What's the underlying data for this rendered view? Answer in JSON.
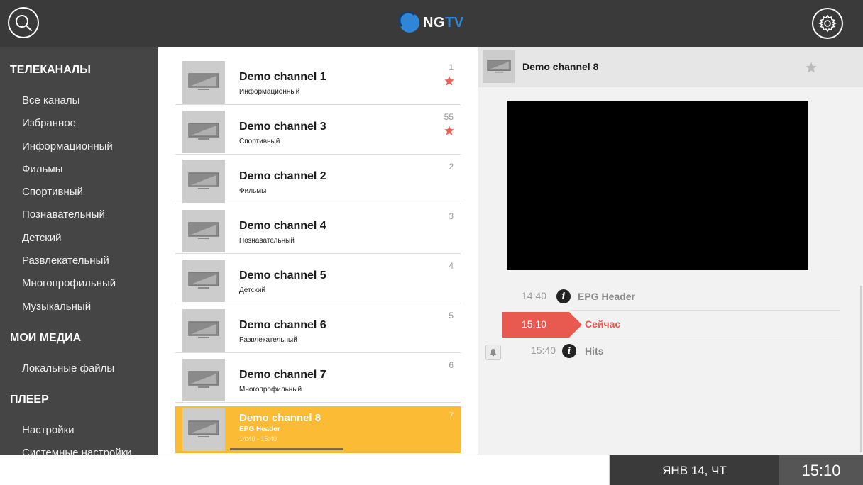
{
  "header": {
    "logo_text": "NG",
    "logo_text_accent": "TV",
    "colors": {
      "bar": "#3a3a3a",
      "accent": "#2f86d6"
    }
  },
  "sidebar": {
    "sections": [
      {
        "title": "ТЕЛЕКАНАЛЫ",
        "items": [
          "Все каналы",
          "Избранное",
          "Информационный",
          "Фильмы",
          "Спортивный",
          "Познавательный",
          "Детский",
          "Развлекательный",
          "Многопрофильный",
          "Музыкальный"
        ]
      },
      {
        "title": "МОИ МЕДИА",
        "items": [
          "Локальные файлы"
        ]
      },
      {
        "title": "ПЛЕЕР",
        "items": [
          "Настройки",
          "Системные настройки"
        ]
      }
    ]
  },
  "channels": [
    {
      "name": "Demo channel 1",
      "category": "Информационный",
      "number": "1",
      "favorite": true
    },
    {
      "name": "Demo channel 3",
      "category": "Спортивный",
      "number": "55",
      "favorite": true
    },
    {
      "name": "Demo channel 2",
      "category": "Фильмы",
      "number": "2",
      "favorite": false
    },
    {
      "name": "Demo channel 4",
      "category": "Познавательный",
      "number": "3",
      "favorite": false
    },
    {
      "name": "Demo channel 5",
      "category": "Детский",
      "number": "4",
      "favorite": false
    },
    {
      "name": "Demo channel 6",
      "category": "Развлекательный",
      "number": "5",
      "favorite": false
    },
    {
      "name": "Demo channel 7",
      "category": "Многопрофильный",
      "number": "6",
      "favorite": false
    }
  ],
  "selected_channel": {
    "name": "Demo channel 8",
    "epg": "EPG Header",
    "time": "14:40 - 15:40",
    "number": "7",
    "progress": 0.5
  },
  "detail": {
    "title": "Demo channel 8",
    "epg": [
      {
        "time": "14:40",
        "title": "EPG Header"
      },
      {
        "time": "15:10",
        "title": "Сейчас",
        "now": true
      },
      {
        "time": "15:40",
        "title": "Hits",
        "reminder": true
      }
    ]
  },
  "status": {
    "date": "ЯНВ 14, ЧТ",
    "time": "15:10"
  },
  "colors": {
    "selected_row": "#fbbb34",
    "now_badge": "#e85a4f",
    "favorite_star": "#e8645a"
  }
}
